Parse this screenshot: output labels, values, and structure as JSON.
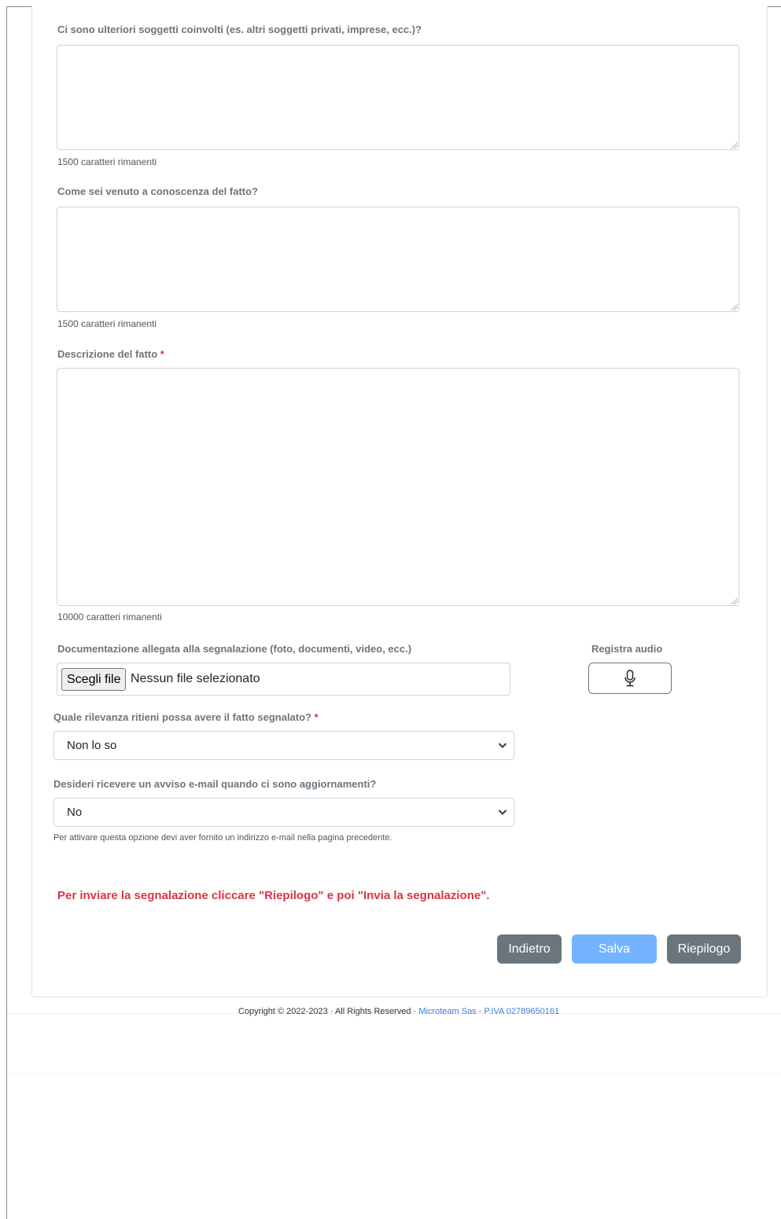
{
  "fields": {
    "other_subjects": {
      "label": "Ci sono ulteriori soggetti coinvolti (es. altri soggetti privati, imprese, ecc.)?",
      "counter": "1500 caratteri rimanenti"
    },
    "how_known": {
      "label": "Come sei venuto a conoscenza del fatto?",
      "counter": "1500 caratteri rimanenti"
    },
    "description": {
      "label": "Descrizione del fatto",
      "required_mark": "*",
      "counter": "10000 caratteri rimanenti"
    },
    "attachments": {
      "label": "Documentazione allegata alla segnalazione (foto, documenti, video, ecc.)",
      "button": "Scegli file",
      "status": "Nessun file selezionato"
    },
    "audio": {
      "label": "Registra audio",
      "icon": "microphone-icon"
    },
    "relevance": {
      "label": "Quale rilevanza ritieni possa avere il fatto segnalato?",
      "required_mark": "*",
      "value": "Non lo so"
    },
    "email_notify": {
      "label": "Desideri ricevere un avviso e-mail quando ci sono aggiornamenti?",
      "value": "No",
      "help": "Per attivare questa opzione devi aver fornito un indirizzo e-mail nella pagina precedente."
    }
  },
  "warning": "Per inviare la segnalazione cliccare \"Riepilogo\" e poi \"Invia la segnalazione\".",
  "buttons": {
    "back": "Indietro",
    "save": "Salva",
    "summary": "Riepilogo"
  },
  "footer": {
    "copyright": "Copyright © 2022-2023 · All Rights Reserved · ",
    "company": "Microteam Sas - P.IVA 02789650161"
  },
  "colors": {
    "required": "#dc3545",
    "secondary_button": "#6c757d",
    "primary_button_disabled": "#74b3ff",
    "link": "#3b7be0"
  }
}
